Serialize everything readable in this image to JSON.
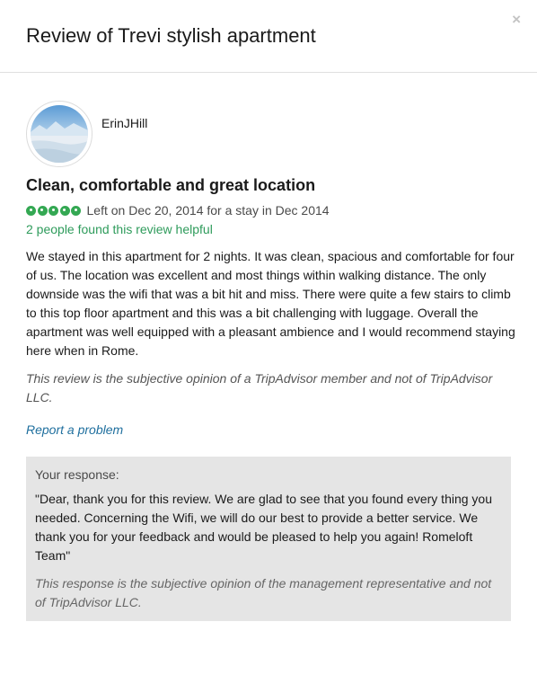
{
  "header": {
    "title": "Review of Trevi stylish apartment",
    "close_glyph": "×"
  },
  "reviewer": {
    "name": "ErinJHill",
    "avatar_icon": "avatar-landscape"
  },
  "review": {
    "title": "Clean, comfortable and great location",
    "rating": 5,
    "rating_max": 5,
    "rating_color": "#34a853",
    "date_line": "Left on Dec 20, 2014 for a stay in Dec 2014",
    "helpful": "2 people found this review helpful",
    "body": "We stayed in this apartment for 2 nights. It was clean, spacious and comfortable for four of us. The location was excellent and most things within walking distance. The only downside was the wifi that was a bit hit and miss. There were quite a few stairs to climb to this top floor apartment and this was a bit challenging with luggage. Overall the apartment was well equipped with a pleasant ambience and I would recommend staying here when in Rome.",
    "disclaimer": "This review is the subjective opinion of a TripAdvisor member and not of TripAdvisor LLC.",
    "report_link": "Report a problem"
  },
  "response": {
    "label": "Your response:",
    "text": "\"Dear, thank you for this review. We are glad to see that you found every thing you needed. Concerning the Wifi, we will do our best to provide a better service. We thank you for your feedback and would be pleased to help you again! Romeloft Team\"",
    "disclaimer": "This response is the subjective opinion of the management representative and not of TripAdvisor LLC."
  },
  "colors": {
    "helpful": "#2e9b5b",
    "link": "#1f6f9e",
    "response_bg": "#e5e5e5"
  }
}
